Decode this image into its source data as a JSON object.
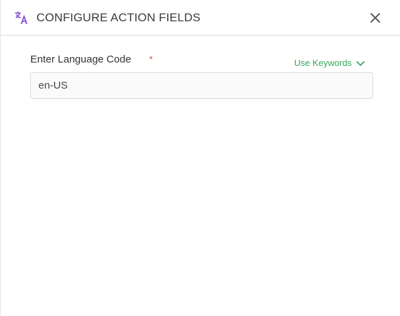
{
  "header": {
    "title": "CONFIGURE ACTION FIELDS",
    "icon": "translate-icon",
    "close_icon": "close-icon"
  },
  "form": {
    "language_field": {
      "label": "Enter Language Code",
      "required_marker": "*",
      "value": "en-US"
    },
    "use_keywords": {
      "label": "Use Keywords",
      "icon": "chevron-down-icon"
    }
  },
  "colors": {
    "accent_purple": "#7b4bd6",
    "keyword_green": "#36a85a",
    "required_red": "#d9534f",
    "title_text": "#3a3a3a"
  }
}
